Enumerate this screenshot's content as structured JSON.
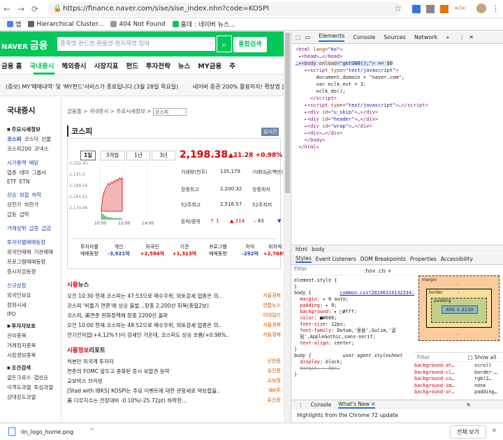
{
  "browser": {
    "url": "https://finance.naver.com/sise/sise_index.nhn?code=KOSPI",
    "bookmarks": [
      {
        "label": "앱",
        "color": "#4285f4"
      },
      {
        "label": "Hierarchical Cluster...",
        "color": "#5f6368"
      },
      {
        "label": "404 Not Found",
        "color": "#999999"
      },
      {
        "label": "홈데 : 네이버 뉴스...",
        "color": "#03c75a"
      }
    ]
  },
  "header": {
    "logo": "NAVER",
    "logo_sub": "금융",
    "search_placeholder": "종목명·펀드명·환율명·원자재명 입력",
    "search_btn": "통합검색"
  },
  "gnb": [
    "금융 홈",
    "국내증시",
    "해외증시",
    "시장지표",
    "펀드",
    "투자전략",
    "뉴스",
    "MY금융",
    "주"
  ],
  "ticker": {
    "left": "(증보) MY'매매내역' 및 'MY펀드'서비스가 종료됩니다.(3월 28일 목요일)",
    "right": "네이버 증권 200% 활용하자! 확장앱 출시"
  },
  "sidebar": {
    "title": "국내증시",
    "sections": [
      {
        "title": "주요시세정보",
        "items": [
          [
            "코스피",
            "코스닥",
            "선물"
          ],
          [
            "코스피200",
            "코넥스"
          ]
        ]
      },
      {
        "title": "",
        "items": [
          [
            "시가총액",
            "배당"
          ],
          [
            "업종",
            "테마",
            "그룹사"
          ],
          [
            "ETF",
            "ETN"
          ]
        ]
      },
      {
        "title": "",
        "items": [
          [
            "상승",
            "보합",
            "하락"
          ],
          [
            "상한가",
            "하한가"
          ],
          [
            "급등",
            "급락"
          ]
        ]
      },
      {
        "title": "",
        "items": [
          [
            "거래상위",
            "급증",
            "급감"
          ]
        ]
      },
      {
        "title": "",
        "items": [
          [
            "투자자별매매동향"
          ],
          [
            "외국인매매",
            "기관매매"
          ],
          [
            "프로그램매매동향"
          ],
          [
            "증시자금동향"
          ]
        ]
      },
      {
        "title": "",
        "items": [
          [
            "신규상장"
          ],
          [
            "외국인보유"
          ],
          [
            "장외시세"
          ],
          [
            "IPO"
          ]
        ]
      },
      {
        "title": "투자자보호",
        "items": [
          [
            "관리종목"
          ],
          [
            "거래정지종목"
          ],
          [
            "시장경보종목"
          ]
        ]
      },
      {
        "title": "조건검색",
        "items": [
          [
            "골든크로스",
            "갭상승"
          ],
          [
            "이격도과열",
            "투심과열"
          ],
          [
            "상대강도과열"
          ]
        ]
      }
    ]
  },
  "main": {
    "breadcrumb": "금융홈 > 국내증시 > 주요시세정보 >",
    "breadcrumb_select": "코스피",
    "title": "코스피",
    "realtime_badge": "실시간",
    "periods": [
      "1일",
      "3개월",
      "1년",
      "3년"
    ],
    "price": "2,198.38",
    "change": "▲21.28",
    "change_pct": "+0.98%",
    "yaxis": [
      "2,202.45",
      "2,195.5",
      "2,188.56",
      "2,181.61",
      "2,174.66"
    ],
    "xaxis": [
      "10:00",
      "12:00",
      "14:00"
    ],
    "metrics": [
      {
        "label": "거래량(천주)",
        "value": "135,179",
        "label2": "거래대금(백만)"
      },
      {
        "label": "장중최고",
        "value": "2,200.32",
        "label2": "장중최저"
      },
      {
        "label": "52주최고",
        "value": "2,516.57",
        "label2": "52주최저"
      }
    ],
    "updown_label": "등락/종목",
    "updown": [
      "1",
      "314",
      "83"
    ],
    "investors": [
      {
        "label": "투자자별\n매매동향",
        "value": ""
      },
      {
        "label": "개인",
        "value": "-3,921억"
      },
      {
        "label": "외국인",
        "value": "+2,594억"
      },
      {
        "label": "기관",
        "value": "+1,313억"
      },
      {
        "label": "프로그램\n매매동향",
        "value": ""
      },
      {
        "label": "차익",
        "value": "-292억"
      },
      {
        "label": "비차익",
        "value": "+2,766억"
      }
    ],
    "news1": {
      "title_red": "시황",
      "title": "뉴스",
      "items": [
        {
          "text": "오전 10:30 현재 코스피는 47:53으로 매수우위, 외토강세 업종은 의..",
          "src": "서울경제"
        },
        {
          "text": "코스피 '비둘기 연준'에 상승 출발…장중 2,200선 회복(종합2보)",
          "src": "연합뉴스"
        },
        {
          "text": "코스피, 美연준 완화정책에 장중 2200선 돌파",
          "src": "이데일리"
        },
        {
          "text": "오전 10:00 현재 코스피는 48:52으로 매수우위, 외토강세 업종은 의..",
          "src": "서울경제"
        },
        {
          "text": "전기전자업(+4.12%↑)이 강세인 가운데, 코스피도 상승 흐름(+0.98%..",
          "src": "서울경제"
        }
      ]
    },
    "news2": {
      "title_red": "시황정보",
      "title": "리포트",
      "items": [
        {
          "text": "처분만 미국계 투자자",
          "src": "신한증"
        },
        {
          "text": "연준의 FOMC 앞두고 종화된 증시 보합권 등락",
          "src": "유진증"
        },
        {
          "text": "교보박스 브리핑",
          "src": "교보증"
        },
        {
          "text": "[Stad with IBKS] KOSPI는 주요 이벤트에 대한 관망세로 약보합을..",
          "src": "IBK투"
        },
        {
          "text": "美 다우지수는 전장대비 -0.10%(-25.72pt) 하락한...",
          "src": "유진증"
        }
      ]
    }
  },
  "devtools": {
    "tabs": [
      "Elements",
      "Console",
      "Sources",
      "Network"
    ],
    "crumbs": [
      "html",
      "body"
    ],
    "style_tabs": [
      "Styles",
      "Event Listeners",
      "DOM Breakpoints",
      "Properties",
      "Accessibility"
    ],
    "filter": "Filter",
    "hov": ":hov  .cls  +",
    "box_labels": {
      "margin": "margin",
      "border": "border",
      "padding": "padding",
      "content": "635 × 2110",
      "dash": "-"
    },
    "computed_filter": "Filter",
    "show_all": "Show all",
    "computed": [
      {
        "prop": "background-at…",
        "val": "scroll"
      },
      {
        "prop": "background-cl…",
        "val": "border-…"
      },
      {
        "prop": "background-co…",
        "val": "rgb(2…"
      },
      {
        "prop": "background-im…",
        "val": "none"
      },
      {
        "prop": "background-or…",
        "val": "padding…"
      }
    ],
    "drawer_tabs": [
      "Console",
      "What's New ×"
    ],
    "drawer_text": "Highlights from the Chrome 72 update"
  },
  "download": {
    "file": "lin_logo_home.png",
    "show_all": "전체 보기"
  },
  "colors": {
    "accent": "#03c75a",
    "up": "#d60000",
    "down": "#1a44b8"
  }
}
